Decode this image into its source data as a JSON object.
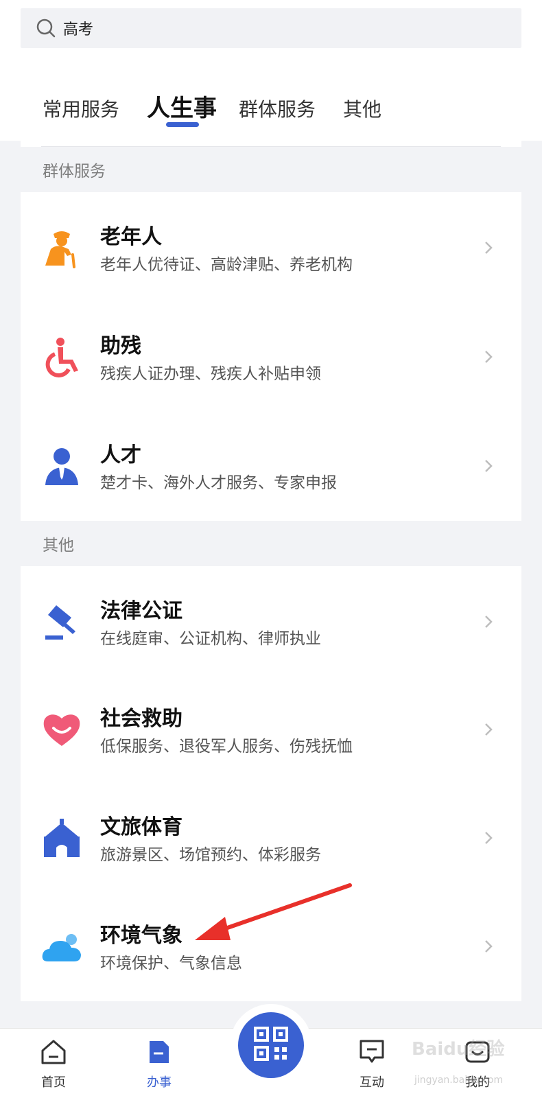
{
  "search": {
    "value": "高考"
  },
  "tabs": [
    {
      "label": "常用服务",
      "active": false
    },
    {
      "label": "人生事",
      "active": true
    },
    {
      "label": "群体服务",
      "active": false
    },
    {
      "label": "其他",
      "active": false
    }
  ],
  "sections": [
    {
      "title": "群体服务",
      "items": [
        {
          "title": "老年人",
          "subtitle": "老年人优待证、高龄津贴、养老机构",
          "icon": "elderly-icon"
        },
        {
          "title": "助残",
          "subtitle": "残疾人证办理、残疾人补贴申领",
          "icon": "wheelchair-icon"
        },
        {
          "title": "人才",
          "subtitle": "楚才卡、海外人才服务、专家申报",
          "icon": "person-tie-icon"
        }
      ]
    },
    {
      "title": "其他",
      "items": [
        {
          "title": "法律公证",
          "subtitle": "在线庭审、公证机构、律师执业",
          "icon": "gavel-icon"
        },
        {
          "title": "社会救助",
          "subtitle": "低保服务、退役军人服务、伤残抚恤",
          "icon": "heart-smile-icon"
        },
        {
          "title": "文旅体育",
          "subtitle": "旅游景区、场馆预约、体彩服务",
          "icon": "building-icon"
        },
        {
          "title": "环境气象",
          "subtitle": "环境保护、气象信息",
          "icon": "cloud-icon"
        }
      ]
    }
  ],
  "bottom_nav": [
    {
      "label": "首页",
      "icon": "home-icon",
      "active": false
    },
    {
      "label": "办事",
      "icon": "document-icon",
      "active": true
    },
    {
      "label": "",
      "icon": "qr-code-icon",
      "active": false
    },
    {
      "label": "互动",
      "icon": "chat-icon",
      "active": false
    },
    {
      "label": "我的",
      "icon": "profile-icon",
      "active": false
    }
  ],
  "watermark": {
    "text": "Baidu经验",
    "sub": "jingyan.baidu.com"
  },
  "colors": {
    "accent": "#3a61d1",
    "orange": "#f7931e",
    "red": "#f0505a",
    "blue": "#3a61d1",
    "pink": "#f05a78",
    "sky": "#2fa3f0",
    "arrow": "#e8302a"
  }
}
